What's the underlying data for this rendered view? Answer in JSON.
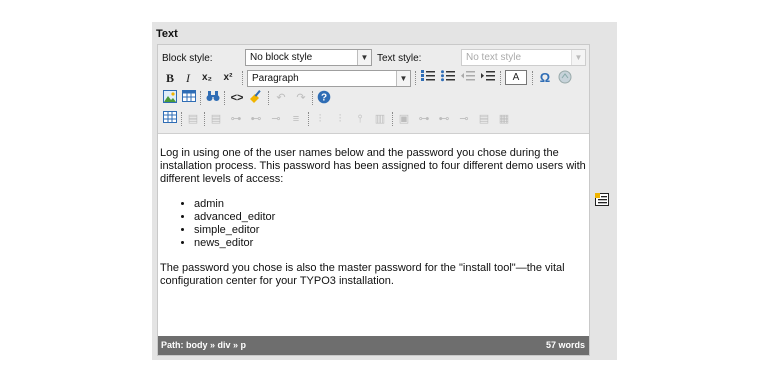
{
  "section_label": "Text",
  "row1": {
    "block_style_label": "Block style:",
    "block_style_value": "No block style",
    "text_style_label": "Text style:",
    "text_style_value": "No text style"
  },
  "toolbar1": {
    "bold": "B",
    "italic": "I",
    "subscript": "x₂",
    "superscript": "x²",
    "format_value": "Paragraph",
    "textcolor": "A",
    "special_char": "Ω"
  },
  "content": {
    "intro": "Log in using one of the user names below and the password you chose during the installation process. This password has been assigned to four different demo users with different levels of access:",
    "users": [
      "admin",
      "advanced_editor",
      "simple_editor",
      "news_editor"
    ],
    "outro": "The password you chose is also the master password for the \"install tool\"—the vital configuration center for your TYPO3 installation."
  },
  "statusbar": {
    "path": "Path:  body  »  div  »  p",
    "word_count": "57 words"
  },
  "colors": {
    "statusbar": "#6e6e6e",
    "panel": "#e4e4e4",
    "accent": "#2f6db5"
  }
}
